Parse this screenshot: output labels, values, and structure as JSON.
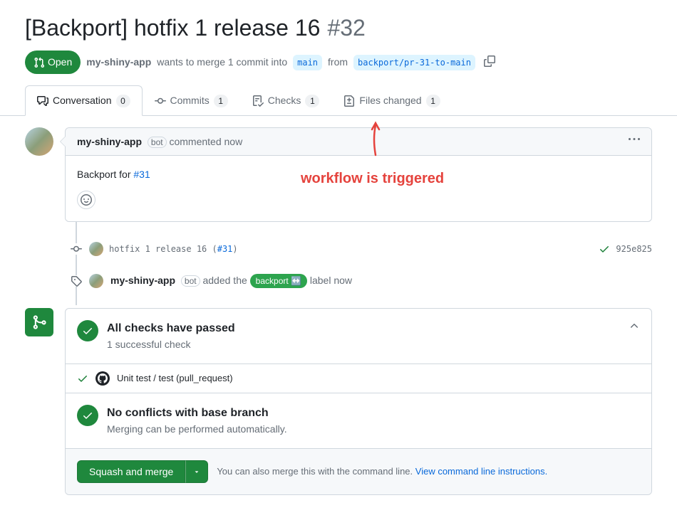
{
  "pr": {
    "title": "[Backport] hotfix 1 release 16",
    "number": "#32",
    "state": "Open",
    "author": "my-shiny-app",
    "merge_text_1": "wants to merge 1 commit into",
    "base_branch": "main",
    "merge_text_2": "from",
    "head_branch": "backport/pr-31-to-main"
  },
  "tabs": {
    "conversation": {
      "label": "Conversation",
      "count": "0"
    },
    "commits": {
      "label": "Commits",
      "count": "1"
    },
    "checks": {
      "label": "Checks",
      "count": "1"
    },
    "files": {
      "label": "Files changed",
      "count": "1"
    }
  },
  "comment": {
    "author": "my-shiny-app",
    "bot_label": "bot",
    "action": "commented now",
    "body_prefix": "Backport for ",
    "body_link": "#31"
  },
  "commit_event": {
    "message": "hotfix 1 release 16 (",
    "link": "#31",
    "suffix": ")",
    "sha": "925e825"
  },
  "label_event": {
    "author": "my-shiny-app",
    "bot_label": "bot",
    "text_before": "added the",
    "label_name": "backport ↔️",
    "text_after": "label now"
  },
  "annotation": "workflow is triggered",
  "merge": {
    "checks_title": "All checks have passed",
    "checks_sub": "1 successful check",
    "check_item": "Unit test / test (pull_request)",
    "conflicts_title": "No conflicts with base branch",
    "conflicts_sub": "Merging can be performed automatically.",
    "button": "Squash and merge",
    "hint": "You can also merge this with the command line. ",
    "hint_link": "View command line instructions."
  }
}
